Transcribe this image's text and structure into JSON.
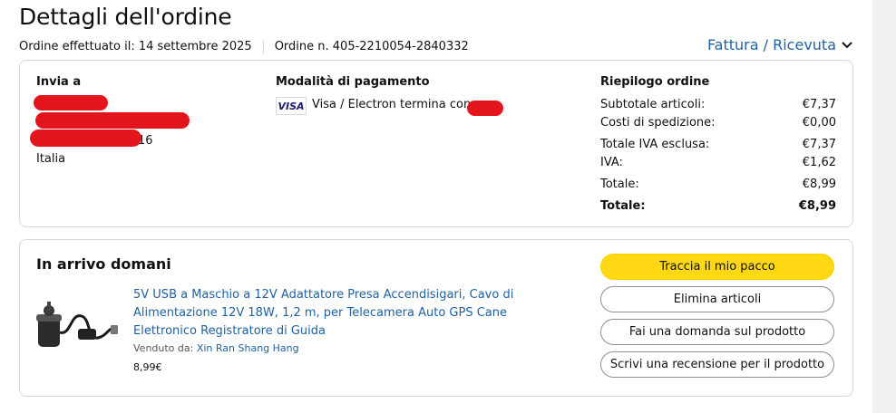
{
  "header": {
    "title": "Dettagli dell'ordine",
    "order_date": "Ordine effettuato il: 14 settembre 2025",
    "order_number": "Ordine n. 405-2210054-2840332",
    "invoice_link": "Fattura / Ricevuta"
  },
  "shipping": {
    "heading": "Invia a",
    "partial_line": "16",
    "country": "Italia"
  },
  "payment": {
    "heading": "Modalità di pagamento",
    "card_brand": "VISA",
    "card_text": "Visa / Electron termina con"
  },
  "summary": {
    "heading": "Riepilogo ordine",
    "rows": [
      {
        "label": "Subtotale articoli:",
        "value": "€7,37"
      },
      {
        "label": "Costi di spedizione:",
        "value": "€0,00"
      },
      {
        "label": "Totale IVA esclusa:",
        "value": "€7,37"
      },
      {
        "label": "IVA:",
        "value": "€1,62"
      },
      {
        "label": "Totale:",
        "value": "€8,99"
      }
    ],
    "grand_total_label": "Totale:",
    "grand_total_value": "€8,99"
  },
  "shipment": {
    "heading": "In arrivo domani",
    "product_title": "5V USB a Maschio a 12V Adattatore Presa Accendisigari, Cavo di Alimentazione 12V 18W, 1,2 m, per Telecamera Auto GPS Cane Elettronico Registratore di Guida",
    "sold_by_label": "Venduto da:",
    "seller": "Xin Ran Shang Hang",
    "price": "8,99€"
  },
  "actions": {
    "track": "Traccia il mio pacco",
    "delete": "Elimina articoli",
    "ask": "Fai una domanda sul prodotto",
    "review": "Scrivi una recensione per il prodotto"
  },
  "colors": {
    "link": "#2162a1",
    "primary_button": "#ffd814",
    "redaction": "#e3141b"
  }
}
